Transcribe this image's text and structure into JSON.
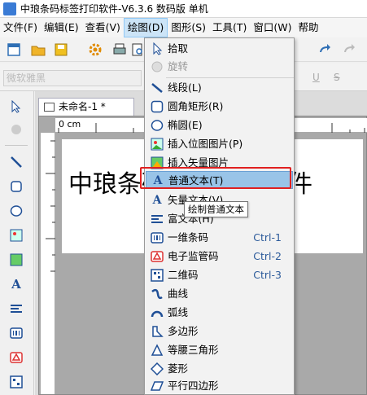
{
  "window": {
    "title": "中琅条码标签打印软件-V6.3.6 数码版 单机"
  },
  "menubar": [
    "文件(F)",
    "编辑(E)",
    "查看(V)",
    "绘图(D)",
    "图形(S)",
    "工具(T)",
    "窗口(W)",
    "帮助"
  ],
  "fontbar": {
    "font_name": "微软雅黑",
    "underline": "U",
    "strike": "S"
  },
  "doc": {
    "tab_label": "未命名-1 *",
    "ruler_unit": "0 cm",
    "canvas_text": "中琅条码标签打印软件"
  },
  "dropdown": {
    "items": [
      {
        "label": "拾取",
        "icon": "pointer-icon"
      },
      {
        "label": "旋转",
        "icon": "rotate-icon",
        "disabled": true
      },
      {
        "label": "线段(L)",
        "icon": "line-icon"
      },
      {
        "label": "圆角矩形(R)",
        "icon": "rounded-rect-icon"
      },
      {
        "label": "椭圆(E)",
        "icon": "ellipse-icon"
      },
      {
        "label": "插入位图图片(P)",
        "icon": "bitmap-icon"
      },
      {
        "label": "插入矢量图片",
        "icon": "vector-image-icon"
      },
      {
        "label": "普通文本(T)",
        "icon": "text-icon",
        "highlighted": true
      },
      {
        "label": "矢量文本(V)",
        "icon": "vector-text-icon"
      },
      {
        "label": "富文本(H)",
        "icon": "rich-text-icon"
      },
      {
        "label": "一维条码",
        "icon": "barcode-icon",
        "shortcut": "Ctrl-1"
      },
      {
        "label": "电子监管码",
        "icon": "ecode-icon",
        "shortcut": "Ctrl-2"
      },
      {
        "label": "二维码",
        "icon": "qrcode-icon",
        "shortcut": "Ctrl-3"
      },
      {
        "label": "曲线",
        "icon": "curve-icon"
      },
      {
        "label": "弧线",
        "icon": "arc-icon"
      },
      {
        "label": "多边形",
        "icon": "polygon-icon"
      },
      {
        "label": "等腰三角形",
        "icon": "triangle-icon"
      },
      {
        "label": "菱形",
        "icon": "diamond-icon"
      },
      {
        "label": "平行四边形",
        "icon": "parallelogram-icon"
      }
    ]
  },
  "tooltip": {
    "text": "绘制普通文本"
  }
}
